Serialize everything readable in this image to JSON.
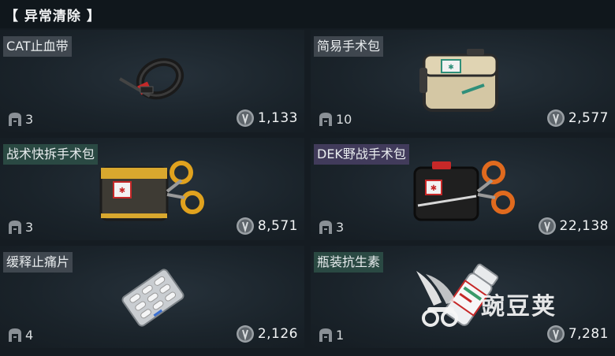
{
  "header": {
    "title": "【 异常清除 】"
  },
  "items": [
    {
      "name": "CAT止血带",
      "qty": "3",
      "price": "1,133",
      "icon": "tourniquet-icon",
      "tag_color": "gray"
    },
    {
      "name": "简易手术包",
      "qty": "10",
      "price": "2,577",
      "icon": "simple-surgery-kit-icon",
      "tag_color": "gray"
    },
    {
      "name": "战术快拆手术包",
      "qty": "3",
      "price": "8,571",
      "icon": "tactical-surgery-kit-icon",
      "tag_color": "green"
    },
    {
      "name": "DEK野战手术包",
      "qty": "3",
      "price": "22,138",
      "icon": "dek-field-surgery-kit-icon",
      "tag_color": "purple"
    },
    {
      "name": "缓释止痛片",
      "qty": "4",
      "price": "2,126",
      "icon": "painkiller-blister-icon",
      "tag_color": "gray"
    },
    {
      "name": "瓶装抗生素",
      "qty": "1",
      "price": "7,281",
      "icon": "antibiotic-bottle-icon",
      "tag_color": "green"
    }
  ],
  "watermark": {
    "text": "豌豆荚",
    "icon": "wandoujia-logo-icon"
  },
  "colors": {
    "background": "#151c22",
    "tag_gray": "#464e56",
    "tag_green": "#2c4e46",
    "tag_purple": "#463e60"
  }
}
